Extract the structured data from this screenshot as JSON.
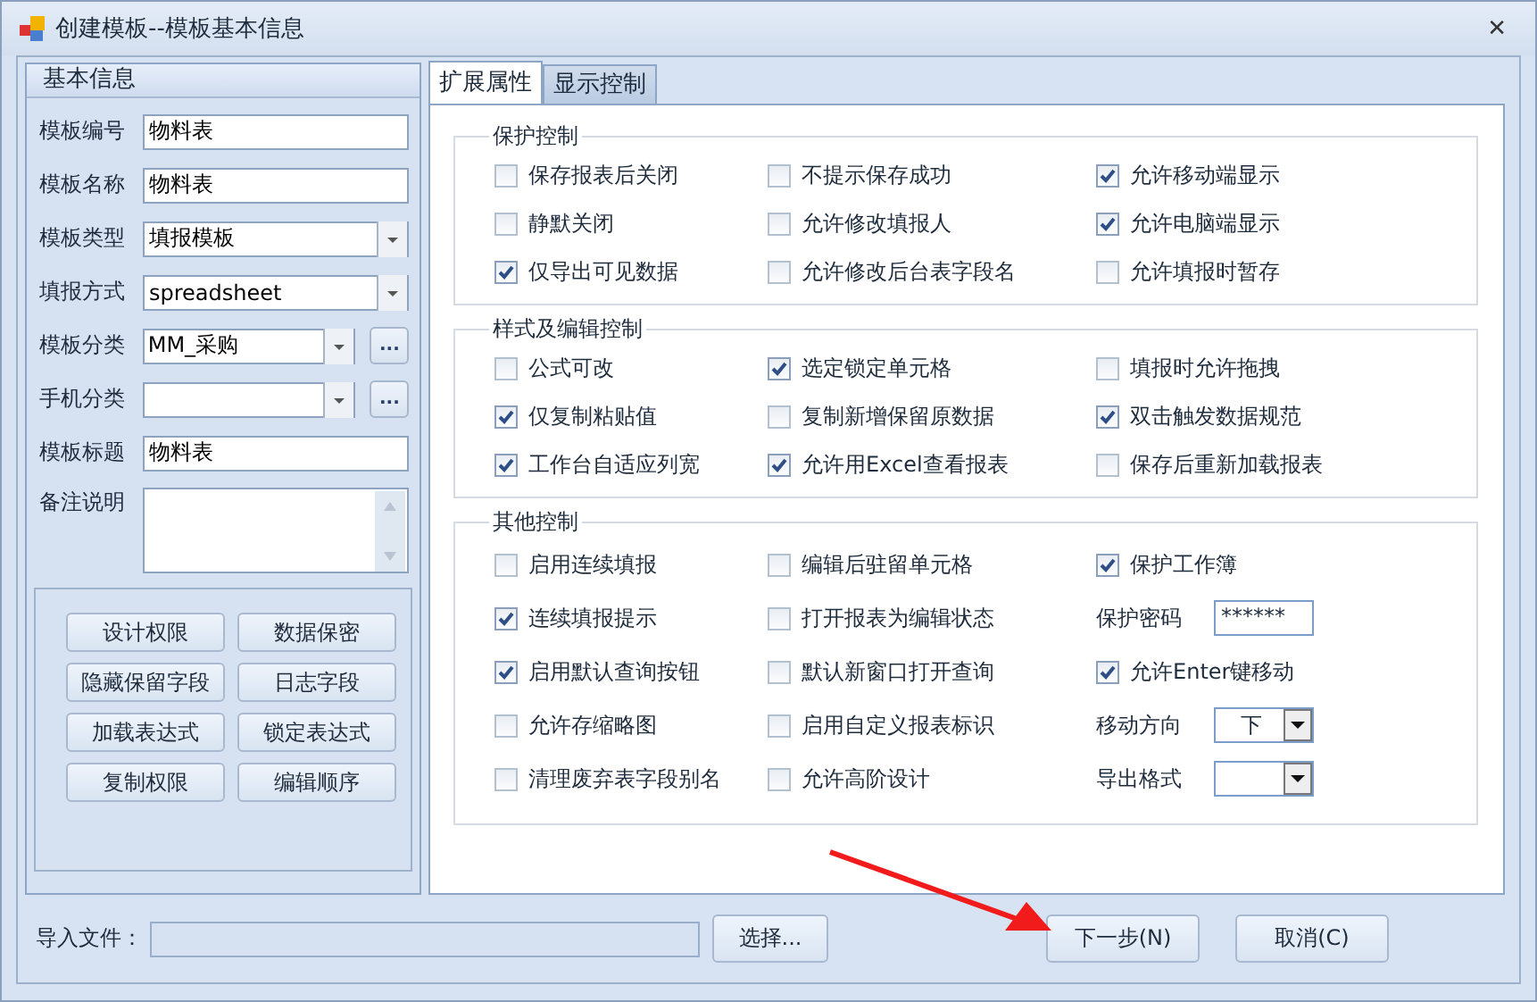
{
  "window": {
    "title": "创建模板--模板基本信息",
    "close": "✕"
  },
  "basic_info": {
    "title": "基本信息",
    "fields": [
      {
        "label": "模板编号",
        "kind": "text",
        "value": "物料表"
      },
      {
        "label": "模板名称",
        "kind": "text",
        "value": "物料表"
      },
      {
        "label": "模板类型",
        "kind": "select",
        "value": "填报模板"
      },
      {
        "label": "填报方式",
        "kind": "select",
        "value": "spreadsheet"
      },
      {
        "label": "模板分类",
        "kind": "select_more",
        "value": "MM_采购",
        "more": "..."
      },
      {
        "label": "手机分类",
        "kind": "select_more",
        "more": "..."
      },
      {
        "label": "模板标题",
        "kind": "text",
        "value": "物料表"
      },
      {
        "label": "备注说明",
        "kind": "textarea"
      }
    ],
    "buttons": [
      "设计权限",
      "数据保密",
      "隐藏保留字段",
      "日志字段",
      "加载表达式",
      "锁定表达式",
      "复制权限",
      "编辑顺序"
    ]
  },
  "tabs": [
    {
      "label": "扩展属性",
      "selected": true
    },
    {
      "label": "显示控制",
      "selected": false
    }
  ],
  "groups": [
    {
      "title": "保护控制",
      "rows": [
        [
          {
            "kind": "checkbox",
            "label": "保存报表后关闭",
            "checked": false
          },
          {
            "kind": "checkbox",
            "label": "不提示保存成功",
            "checked": false
          },
          {
            "kind": "checkbox",
            "label": "允许移动端显示",
            "checked": true
          }
        ],
        [
          {
            "kind": "checkbox",
            "label": "静默关闭",
            "checked": false
          },
          {
            "kind": "checkbox",
            "label": "允许修改填报人",
            "checked": false
          },
          {
            "kind": "checkbox",
            "label": "允许电脑端显示",
            "checked": true
          }
        ],
        [
          {
            "kind": "checkbox",
            "label": "仅导出可见数据",
            "checked": true
          },
          {
            "kind": "checkbox",
            "label": "允许修改后台表字段名",
            "checked": false
          },
          {
            "kind": "checkbox",
            "label": "允许填报时暂存",
            "checked": false
          }
        ]
      ]
    },
    {
      "title": "样式及编辑控制",
      "rows": [
        [
          {
            "kind": "checkbox",
            "label": "公式可改",
            "checked": false
          },
          {
            "kind": "checkbox",
            "label": "选定锁定单元格",
            "checked": true
          },
          {
            "kind": "checkbox",
            "label": "填报时允许拖拽",
            "checked": false
          }
        ],
        [
          {
            "kind": "checkbox",
            "label": "仅复制粘贴值",
            "checked": true
          },
          {
            "kind": "checkbox",
            "label": "复制新增保留原数据",
            "checked": false
          },
          {
            "kind": "checkbox",
            "label": "双击触发数据规范",
            "checked": true
          }
        ],
        [
          {
            "kind": "checkbox",
            "label": "工作台自适应列宽",
            "checked": true
          },
          {
            "kind": "checkbox",
            "label": "允许用Excel查看报表",
            "checked": true
          },
          {
            "kind": "checkbox",
            "label": "保存后重新加载报表",
            "checked": false
          }
        ]
      ]
    },
    {
      "title": "其他控制",
      "rows": [
        [
          {
            "kind": "checkbox",
            "label": "启用连续填报",
            "checked": false
          },
          {
            "kind": "checkbox",
            "label": "编辑后驻留单元格",
            "checked": false
          },
          {
            "kind": "checkbox",
            "label": "保护工作簿",
            "checked": true
          }
        ],
        [
          {
            "kind": "checkbox",
            "label": "连续填报提示",
            "checked": true
          },
          {
            "kind": "checkbox",
            "label": "打开报表为编辑状态",
            "checked": false
          },
          {
            "kind": "password",
            "label": "保护密码",
            "value": "******"
          }
        ],
        [
          {
            "kind": "checkbox",
            "label": "启用默认查询按钮",
            "checked": true
          },
          {
            "kind": "checkbox",
            "label": "默认新窗口打开查询",
            "checked": false
          },
          {
            "kind": "checkbox",
            "label": "允许Enter键移动",
            "checked": true
          }
        ],
        [
          {
            "kind": "checkbox",
            "label": "允许存缩略图",
            "checked": false
          },
          {
            "kind": "checkbox",
            "label": "启用自定义报表标识",
            "checked": false
          },
          {
            "kind": "select",
            "label": "移动方向",
            "value": "下"
          }
        ],
        [
          {
            "kind": "checkbox",
            "label": "清理废弃表字段别名",
            "checked": false
          },
          {
            "kind": "checkbox",
            "label": "允许高阶设计",
            "checked": false
          },
          {
            "kind": "select",
            "label": "导出格式"
          }
        ]
      ]
    }
  ],
  "import": {
    "label": "导入文件：",
    "browse": "选择..."
  },
  "actions": [
    "下一步(N)",
    "取消(C)"
  ]
}
